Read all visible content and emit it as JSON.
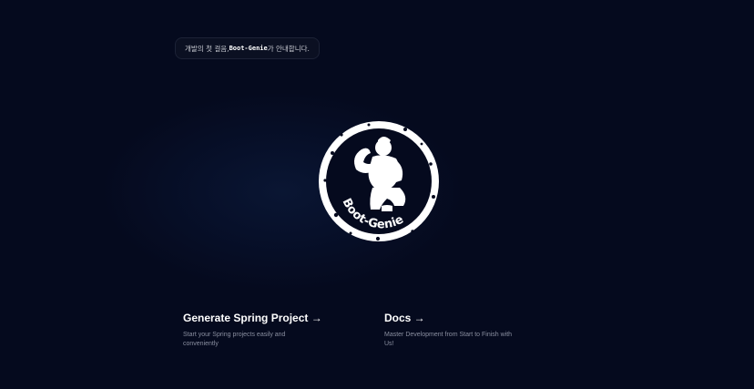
{
  "notice": {
    "prefix": "개발의 첫 걸음, ",
    "brand": "Boot-Genie",
    "suffix": "가 안내합니다."
  },
  "logo": {
    "text": "Boot-Genie",
    "icon": "flexing-genie-icon"
  },
  "cards": {
    "generate": {
      "title": "Generate Spring Project →",
      "description": "Start your Spring projects easily and conveniently"
    },
    "docs": {
      "title": "Docs →",
      "description": "Master Development from Start to Finish with Us!"
    }
  },
  "colors": {
    "background": "#050a1e",
    "text": "#ffffff",
    "muted": "#8a8fa0"
  }
}
